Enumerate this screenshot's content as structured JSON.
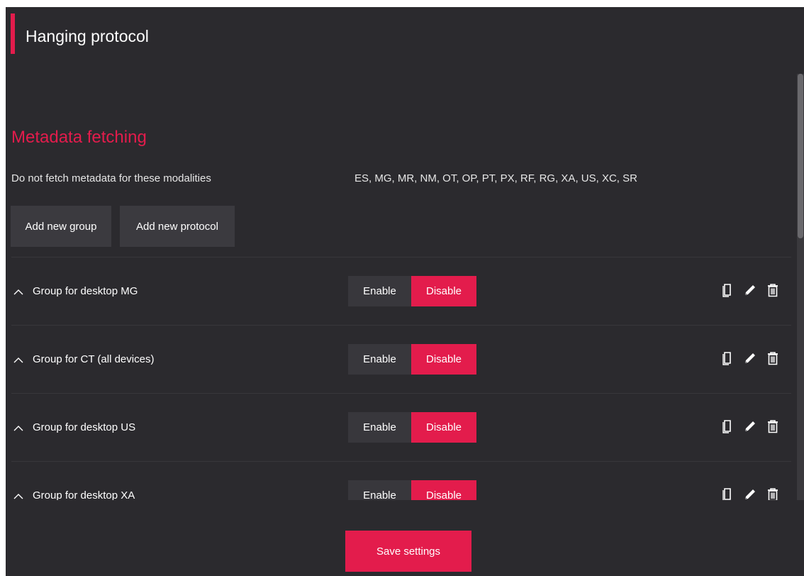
{
  "header": {
    "title": "Hanging protocol"
  },
  "metadata": {
    "section_title": "Metadata fetching",
    "modalities_label": "Do not fetch metadata for these modalities",
    "modalities_value": "ES, MG, MR, NM, OT, OP, PT, PX, RF, RG, XA, US, XC, SR"
  },
  "actions": {
    "add_group": "Add new group",
    "add_protocol": "Add new protocol"
  },
  "groups": [
    {
      "name": "Group for desktop MG",
      "enable_label": "Enable",
      "disable_label": "Disable",
      "selected": "Disable"
    },
    {
      "name": "Group for CT (all devices)",
      "enable_label": "Enable",
      "disable_label": "Disable",
      "selected": "Disable"
    },
    {
      "name": "Group for desktop US",
      "enable_label": "Enable",
      "disable_label": "Disable",
      "selected": "Disable"
    },
    {
      "name": "Group for desktop XA",
      "enable_label": "Enable",
      "disable_label": "Disable",
      "selected": "Disable"
    }
  ],
  "row_icons": [
    "copy-icon",
    "pencil-icon",
    "trash-icon"
  ],
  "footer": {
    "save_label": "Save settings"
  },
  "colors": {
    "accent": "#e31c4c",
    "panel": "#2b2a2e",
    "button": "#3b3a3f"
  }
}
